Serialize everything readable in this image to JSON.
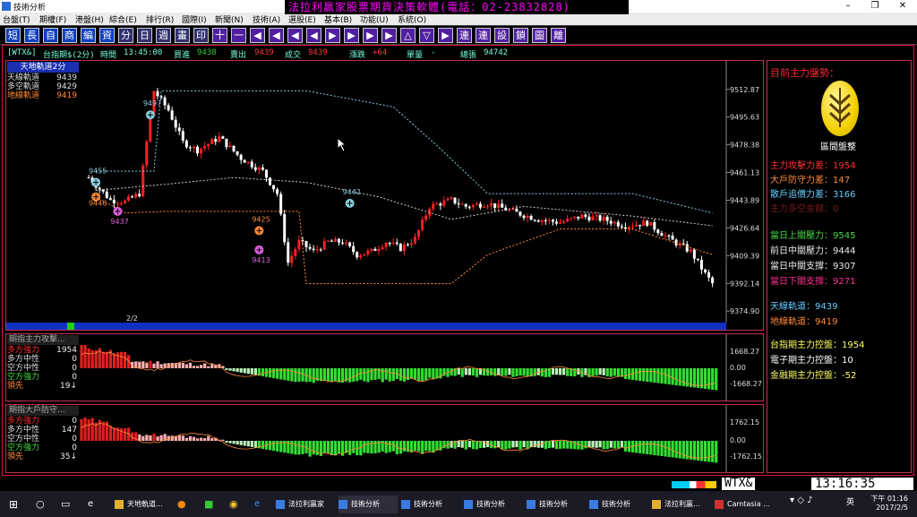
{
  "window": {
    "title": "技術分析",
    "controls": {
      "minimize": "–",
      "maximize": "❐",
      "close": "✕"
    }
  },
  "menu": [
    "台盤(T)",
    "期權(F)",
    "港盤(H)",
    "綜合(E)",
    "排行(R)",
    "國際(I)",
    "新聞(N)",
    "技術(A)",
    "選股(E)",
    "基本(B)",
    "功能(U)",
    "系統(O)"
  ],
  "banner": "法拉利贏家股票期貨決策軟體(電話：02-23832828)",
  "toolbar": [
    "短",
    "長",
    "自",
    "商",
    "編",
    "資",
    "分",
    "日",
    "週",
    "畫",
    "印",
    "十",
    "一",
    "◀",
    "◀",
    "◀",
    "◀",
    "▶",
    "▶",
    "▶",
    "▶",
    "△",
    "▽",
    "▶",
    "連",
    "連",
    "設",
    "鎖",
    "圖",
    "離"
  ],
  "infostrip": {
    "code": "[WTX&]",
    "name": "台指期$(2分)",
    "time_label": "時間",
    "time": "13:45:00",
    "bid_label": "買進",
    "bid": "9438",
    "ask_label": "賣出",
    "ask": "9439",
    "trade_label": "成交",
    "trade": "9439",
    "change_label": "漲跌",
    "change": "+64",
    "vol_label": "單量",
    "vol": "-",
    "total_label": "總張",
    "total": "94742"
  },
  "main_legend": {
    "title": "天地軌道2分",
    "rows": [
      {
        "label": "天線軌道",
        "value": "9439",
        "color": "#dddddd"
      },
      {
        "label": "多空軌道",
        "value": "9429",
        "color": "#dddddd"
      },
      {
        "label": "地線軌道",
        "value": "9419",
        "color": "#ff8a3a"
      }
    ]
  },
  "main_page": "2/2",
  "sub1": {
    "title": "期指主力攻擊...",
    "rows": [
      {
        "label": "多方強力",
        "value": "1954",
        "color": "#ff3030"
      },
      {
        "label": "多方中性",
        "value": "0",
        "color": "#dddddd"
      },
      {
        "label": "空方中性",
        "value": "0",
        "color": "#dddddd"
      },
      {
        "label": "空方強力",
        "value": "0",
        "color": "#44dd44"
      },
      {
        "label": "領先",
        "value": "19↓",
        "color": "#ff8a3a"
      }
    ],
    "ticks": [
      "1668.27",
      "0.00",
      "-1668.27"
    ]
  },
  "sub2": {
    "title": "期指大戶防守...",
    "rows": [
      {
        "label": "多方強力",
        "value": "0",
        "color": "#ff3030"
      },
      {
        "label": "多方中性",
        "value": "147",
        "color": "#dddddd"
      },
      {
        "label": "空方中性",
        "value": "0",
        "color": "#dddddd"
      },
      {
        "label": "空方強力",
        "value": "0",
        "color": "#44dd44"
      },
      {
        "label": "領先",
        "value": "35↓",
        "color": "#ff8a3a"
      }
    ],
    "ticks": [
      "1762.15",
      "0.00",
      "-1762.15"
    ]
  },
  "right": {
    "title": "目前主力盤勢：",
    "logo_caption": "區間盤整",
    "rows": [
      {
        "text": "主力攻擊力差：1954",
        "color": "#ff3030"
      },
      {
        "text": "大戶防守力差：147",
        "color": "#ff8a3a"
      },
      {
        "text": "散戶追價力差：3166",
        "color": "#66ccff"
      },
      {
        "text": "主力多空金額：0",
        "color": "#7a1a1a"
      },
      {
        "text": "當日上關壓力：9545",
        "color": "#44dd44"
      },
      {
        "text": "前日中關壓力：9444",
        "color": "#eeeeee"
      },
      {
        "text": "當日中關支撐：9307",
        "color": "#eeeeee"
      },
      {
        "text": "當日下關支撐：9271",
        "color": "#ff3090"
      },
      {
        "text": "天線軌道：9439",
        "color": "#66ccff"
      },
      {
        "text": "地線軌道：9419",
        "color": "#ff8a3a"
      },
      {
        "text": "台指期主力控盤：1954",
        "color": "#ffff66"
      },
      {
        "text": "電子期主力控盤：10",
        "color": "#ffffff"
      },
      {
        "text": "金融期主力控盤：-52",
        "color": "#ffff66"
      }
    ]
  },
  "status": {
    "code": "WTX&",
    "time": "13:16:35"
  },
  "taskbar": {
    "items": [
      "天地軌道...",
      "法拉利贏家",
      "技術分析",
      "技術分析",
      "技術分析",
      "技術分析",
      "技術分析",
      "法拉利贏...",
      "Camtasia ..."
    ],
    "clock_time": "下午 01:16",
    "clock_date": "2017/2/5",
    "lang": "英"
  },
  "chart_data": {
    "type": "candlestick",
    "title": "台指期$(2分)",
    "y_ticks": [
      9512.87,
      9495.63,
      9478.38,
      9461.13,
      9443.89,
      9426.64,
      9409.39,
      9392.14,
      9374.9
    ],
    "ylim": [
      9370,
      9525
    ],
    "annotations": [
      {
        "label": "9455",
        "x_index": 2,
        "y": 9455
      },
      {
        "label": "9446",
        "x_index": 2,
        "y": 9446
      },
      {
        "label": "9437",
        "x_index": 8,
        "y": 9437
      },
      {
        "label": "9497",
        "x_index": 17,
        "y": 9497
      },
      {
        "label": "9425",
        "x_index": 47,
        "y": 9425
      },
      {
        "label": "9413",
        "x_index": 47,
        "y": 9413
      },
      {
        "label": "9442",
        "x_index": 72,
        "y": 9442
      }
    ]
  }
}
